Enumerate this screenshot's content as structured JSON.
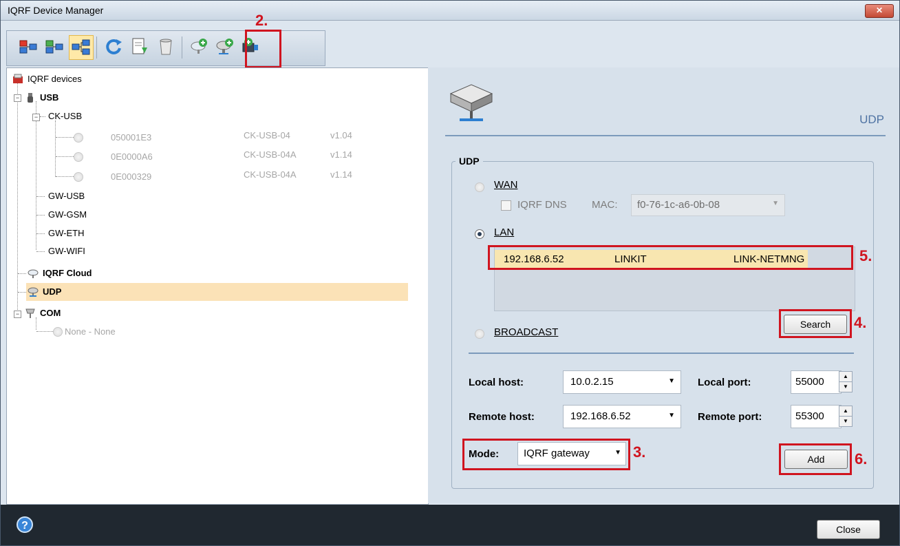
{
  "window": {
    "title": "IQRF Device Manager",
    "close_glyph": "✕"
  },
  "toolbar": {
    "icons": [
      "disconnect-icon",
      "connect-icon",
      "tree-view-icon",
      "refresh-icon",
      "export-icon",
      "delete-icon",
      "add-cloud-icon",
      "add-udp-icon",
      "add-com-icon"
    ],
    "annotation": "2."
  },
  "tree": {
    "root": "IQRF devices",
    "usb": "USB",
    "ck_usb": "CK-USB",
    "devices": [
      {
        "id": "050001E3",
        "model": "CK-USB-04",
        "version": "v1.04"
      },
      {
        "id": "0E0000A6",
        "model": "CK-USB-04A",
        "version": "v1.14"
      },
      {
        "id": "0E000329",
        "model": "CK-USB-04A",
        "version": "v1.14"
      }
    ],
    "gateways": [
      "GW-USB",
      "GW-GSM",
      "GW-ETH",
      "GW-WIFI"
    ],
    "cloud": "IQRF Cloud",
    "udp": "UDP",
    "com": "COM",
    "com_child": "None - None"
  },
  "udp_panel": {
    "header": "UDP",
    "group_title": "UDP",
    "wan_label": "WAN",
    "iqrf_dns_label": "IQRF DNS",
    "mac_label": "MAC:",
    "mac_value": "f0-76-1c-a6-0b-08",
    "lan_label": "LAN",
    "lan_row": {
      "ip": "192.168.6.52",
      "name": "LINKIT",
      "type": "LINK-NETMNG"
    },
    "broadcast_label": "BROADCAST",
    "search_button": "Search",
    "local_host_label": "Local host:",
    "local_host_value": "10.0.2.15",
    "local_port_label": "Local port:",
    "local_port_value": "55000",
    "remote_host_label": "Remote host:",
    "remote_host_value": "192.168.6.52",
    "remote_port_label": "Remote port:",
    "remote_port_value": "55300",
    "mode_label": "Mode:",
    "mode_value": "IQRF gateway",
    "add_button": "Add"
  },
  "annotations": {
    "search": "4.",
    "lan_row": "5.",
    "mode": "3.",
    "add": "6."
  },
  "footer": {
    "close_button": "Close"
  },
  "colors": {
    "annotation_red": "#d0141f",
    "selection": "#fbe2b7",
    "lan_row_bg": "#f8e6b0"
  }
}
